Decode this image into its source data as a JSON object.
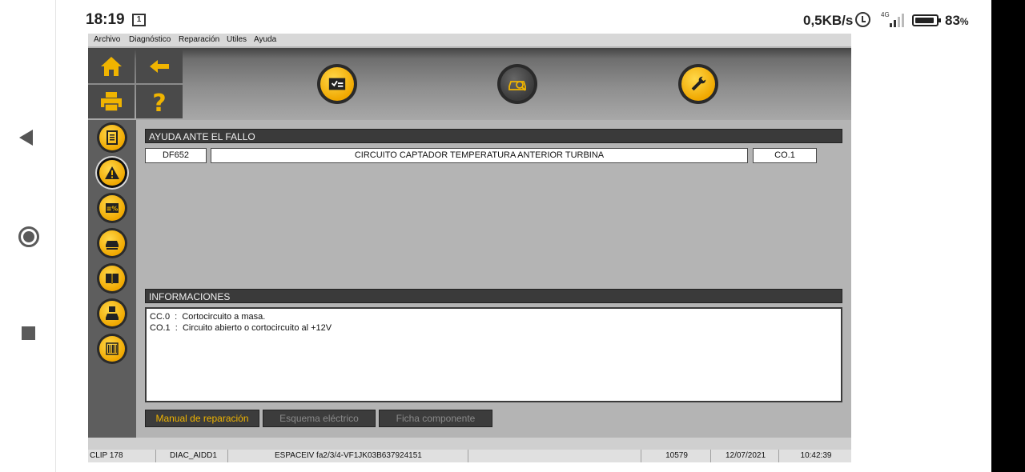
{
  "device": {
    "time": "18:19",
    "notification_badge": "1",
    "net_speed": "0,5KB/s",
    "network_type": "4G",
    "battery_level": "83",
    "battery_unit": "%"
  },
  "menu": {
    "items": [
      "Archivo",
      "Diagnóstico",
      "Reparación",
      "Utiles",
      "Ayuda"
    ]
  },
  "fault_help": {
    "title": "AYUDA ANTE EL FALLO",
    "code": "DF652",
    "description": "CIRCUITO CAPTADOR TEMPERATURA ANTERIOR TURBINA",
    "status": "CO.1"
  },
  "information": {
    "title": "INFORMACIONES",
    "lines": [
      "CC.0  :  Cortocircuito a masa.",
      "CO.1  :  Circuito abierto o cortocircuito al +12V"
    ]
  },
  "actions": {
    "repair_manual": "Manual de reparación",
    "electrical_diagram": "Esquema eléctrico",
    "component_sheet": "Ficha componente"
  },
  "status_bar": {
    "tool": "CLIP 178",
    "module": "DIAC_AIDD1",
    "vehicle": "ESPACEIV fa2/3/4-VF1JK03B637924151",
    "extra": "",
    "counter": "10579",
    "date": "12/07/2021",
    "time": "10:42:39"
  },
  "colors": {
    "accent_yellow": "#f0b400",
    "section_bar": "#3a3a3a",
    "panel_grey": "#b4b4b4",
    "sidebar_grey": "#5e5e5e"
  },
  "icons": {
    "home": "home-icon",
    "back": "back-arrow-icon",
    "print": "printer-icon",
    "help": "question-mark-icon",
    "checklist": "checklist-icon",
    "vehicle_diag": "vehicle-diagnostic-icon",
    "repair": "wrench-icon"
  }
}
